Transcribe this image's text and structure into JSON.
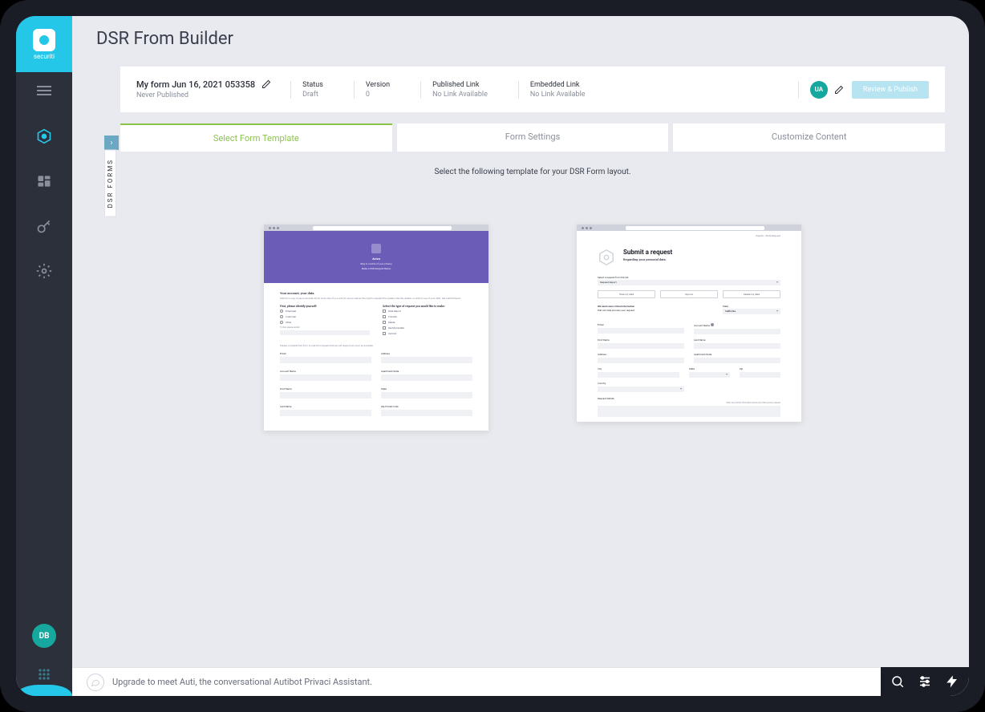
{
  "brand": "securiti",
  "page_title": "DSR From Builder",
  "hamburger_label": "Menu",
  "info_bar": {
    "form_name": "My form Jun 16, 2021 053358",
    "form_sub": "Never Published",
    "status_label": "Status",
    "status_value": "Draft",
    "version_label": "Version",
    "version_value": "0",
    "published_label": "Published Link",
    "published_value": "No Link Available",
    "embedded_label": "Embedded Link",
    "embedded_value": "No Link Available",
    "ua_badge": "UA",
    "review_button": "Review & Publish"
  },
  "tabs": {
    "t1": "Select Form Template",
    "t2": "Form Settings",
    "t3": "Customize Content"
  },
  "side_panel_label": "DSR FORMS",
  "template_instruction": "Select the following template for your DSR Form layout.",
  "template1": {
    "brand": "Aviza",
    "hero_line1": "Stay in control of your privacy",
    "hero_line2": "Make a DSR Request Below",
    "sec1_title": "Your account, your data.",
    "sec1_desc": "Submit a copy of personal data which Aviza has of you and its use as well as the right to request the update, transfer, delete, or restrict use of your data. Get started below.",
    "identify_title": "First, please identify yourself:",
    "radio1": "Employee",
    "radio2": "Customer",
    "radio3": "Other",
    "other_placeholder": "If other, please explain",
    "request_type_title": "Select the type of request you would like to make:",
    "check1": "Data Report",
    "check2": "Transfer",
    "check3": "Delete",
    "check4": "Rectify/Update",
    "check5": "Opt-Out",
    "complete_text": "Please complete this form to submit a request and we will respond as soon as possible.",
    "f_email": "Email",
    "f_address": "Address",
    "f_acct": "Account Name",
    "f_apt": "Apartment/Suite",
    "f_first": "First Name",
    "f_state": "State",
    "f_last": "Last Name",
    "f_zip": "Zip/Postal Code"
  },
  "template2": {
    "lang": "English / Multi Request",
    "title": "Submit a request",
    "subtitle": "Regarding your personal data.",
    "select_label": "Select a request from the list:",
    "select_value": "Request Report",
    "btn1": "Have my data",
    "btn2": "Opt-out",
    "btn3": "Delete my data",
    "critical_label": "We need some critical information",
    "critical_sub": "that can help process your request.",
    "state_label": "State",
    "state_value": "California",
    "f_email": "Email",
    "f_acct": "Account Name",
    "f_first": "First Name",
    "f_last": "Last Name",
    "f_address": "Address",
    "f_apt": "Apartment/Suite",
    "f_city": "City",
    "f_state": "State",
    "f_zip": "Zip",
    "f_country": "Country",
    "f_details": "Request Details",
    "f_details_sub": "Enter any further information about your data privacy request"
  },
  "bottom_bar": {
    "text": "Upgrade to meet Auti, the conversational Autibot Privaci Assistant."
  },
  "user_initials": "DB"
}
